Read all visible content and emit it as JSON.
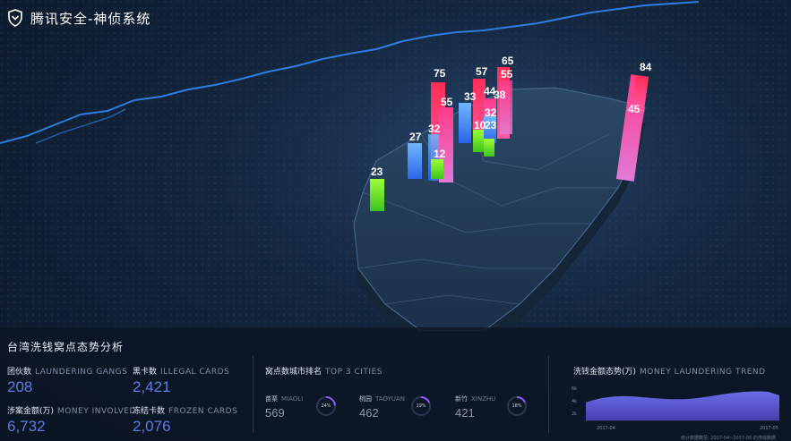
{
  "app": {
    "title": "腾讯安全-神侦系统"
  },
  "map": {
    "bar_values": [
      "75",
      "57",
      "65",
      "55",
      "33",
      "44",
      "38",
      "55",
      "32",
      "10",
      "23",
      "27",
      "32",
      "12",
      "23",
      "84",
      "45"
    ]
  },
  "panel": {
    "title": "台湾洗钱窝点态势分析",
    "stats": [
      {
        "cn": "团伙数",
        "en": "LAUNDERING GANGS",
        "value": "208"
      },
      {
        "cn": "黑卡数",
        "en": "ILLEGAL CARDS",
        "value": "2,421"
      },
      {
        "cn": "涉案金额(万)",
        "en": "MONEY INVOLVED",
        "value": "6,732"
      },
      {
        "cn": "冻结卡数",
        "en": "FROZEN CARDS",
        "value": "2,076"
      }
    ],
    "top_cities": {
      "cn": "窝点数城市排名",
      "en": "TOP 3 CITIES",
      "items": [
        {
          "cn": "苗栗",
          "en": "MIAOLI",
          "value": "569",
          "percent": "24%",
          "fraction": 0.24
        },
        {
          "cn": "桃园",
          "en": "TAOYUAN",
          "value": "462",
          "percent": "19%",
          "fraction": 0.19
        },
        {
          "cn": "新竹",
          "en": "XINZHU",
          "value": "421",
          "percent": "18%",
          "fraction": 0.18
        }
      ]
    },
    "trend": {
      "cn": "洗钱金额态势(万)",
      "en": "MONEY LAUNDERING TREND",
      "y_ticks": [
        "6k",
        "4k",
        "2k"
      ],
      "x_start": "2017-04",
      "x_end": "2017-05"
    },
    "footnote": "统计数据截至: 2017-04~2017-05 的洗钱数据"
  },
  "colors": {
    "accent": "#5d7ce3",
    "ring": "#8b5cf6",
    "coast": "#2f7de0"
  }
}
